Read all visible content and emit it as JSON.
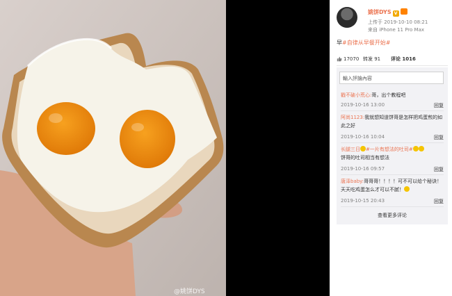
{
  "photo": {
    "watermark": "@姚饼DYS"
  },
  "author": {
    "name": "姚饼DYS",
    "uploaded": "上传于 2019-10-10 08:21",
    "device": "来自 iPhone 11 Pro Max"
  },
  "post": {
    "text_prefix": "早",
    "hashtag": "#自律从早餐开始#"
  },
  "stats": {
    "likes": "17070",
    "reposts_label": "转发 91",
    "comments_label": "评论 1016"
  },
  "comment_box": {
    "placeholder": "輸入評論內容"
  },
  "comments": [
    {
      "user": "戳不破小荒心:",
      "text": "哥，出个教程吧",
      "time": "2019-10-16 13:00",
      "reply": "回复"
    },
    {
      "user": "阿尚1123:",
      "text": "我就想知道饼哥是怎样把鸡蛋煎的如此之好",
      "time": "2019-10-16 10:04",
      "reply": "回复"
    },
    {
      "user": "长腿三日",
      "hashtag": "#一片有想法的吐司#",
      "text": "饼哥的吐司相当有想法",
      "time": "2019-10-16 09:57",
      "reply": "回复"
    },
    {
      "user": "唐泽baby:",
      "text": "哥哥哥！！！！可不可以给个秘诀！天天吃鸡蛋怎么才可以不腻！",
      "time": "2019-10-15 20:43",
      "reply": "回复"
    }
  ],
  "more_comments": "查看更多评论",
  "colors": {
    "accent": "#eb7350",
    "panel_bg": "#ffffff",
    "comments_bg": "#f2f2f5"
  }
}
